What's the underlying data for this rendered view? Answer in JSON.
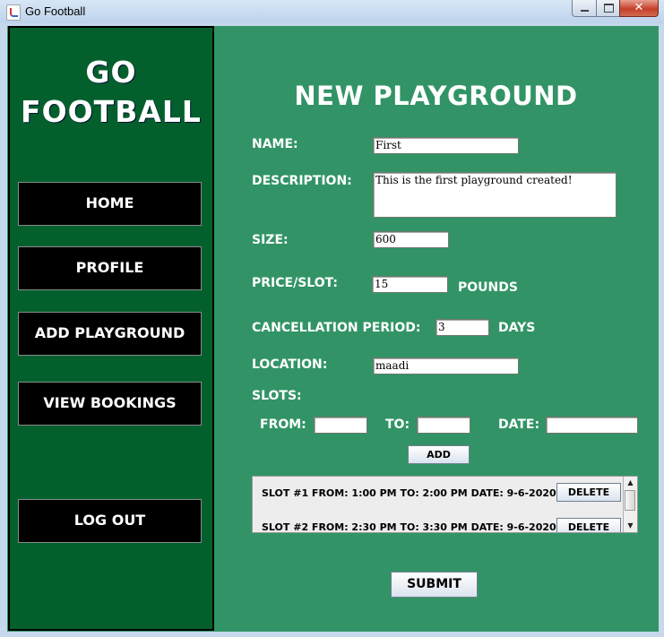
{
  "window": {
    "title": "Go Football"
  },
  "brand": {
    "line1": "GO",
    "line2": "FOOTBALL"
  },
  "sidebar": {
    "items": [
      {
        "label": "HOME"
      },
      {
        "label": "PROFILE"
      },
      {
        "label": "ADD PLAYGROUND"
      },
      {
        "label": "VIEW BOOKINGS"
      },
      {
        "label": "LOG OUT"
      }
    ]
  },
  "form": {
    "heading": "NEW PLAYGROUND",
    "name": {
      "label": "NAME:",
      "value": "First"
    },
    "description": {
      "label": "DESCRIPTION:",
      "value": "This is the first playground created!"
    },
    "size": {
      "label": "SIZE:",
      "value": "600"
    },
    "price": {
      "label": "PRICE/SLOT:",
      "value": "15",
      "unit": "POUNDS"
    },
    "cancellation": {
      "label": "CANCELLATION PERIOD:",
      "value": "3",
      "unit": "DAYS"
    },
    "location": {
      "label": "LOCATION:",
      "value": "maadi"
    },
    "slots_label": "SLOTS:",
    "from": {
      "label": "FROM:",
      "value": ""
    },
    "to": {
      "label": "TO:",
      "value": ""
    },
    "date": {
      "label": "DATE:",
      "value": ""
    },
    "add_button": "ADD",
    "submit_button": "SUBMIT"
  },
  "slots": [
    {
      "text": "SLOT #1  FROM: 1:00 PM  TO: 2:00 PM  DATE: 9-6-2020",
      "delete_label": "DELETE"
    },
    {
      "text": "SLOT #2  FROM: 2:30 PM  TO: 3:30 PM  DATE: 9-6-2020",
      "delete_label": "DELETE"
    }
  ],
  "colors": {
    "sidebar": "#03602d",
    "content": "#329466",
    "nav_button": "#000000"
  }
}
